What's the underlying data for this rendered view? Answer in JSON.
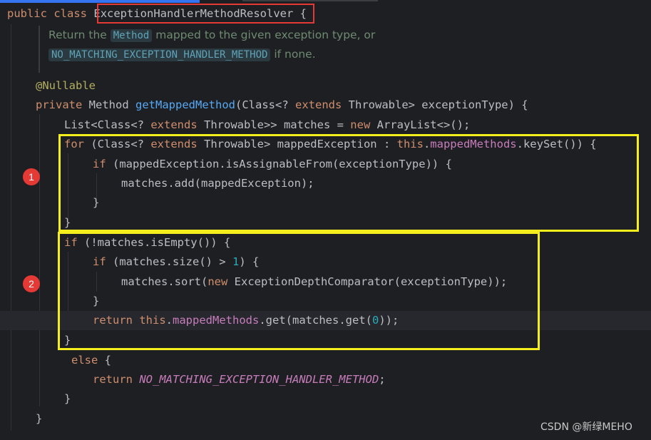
{
  "editor": {
    "class_decl": {
      "kw_public": "public",
      "kw_class": "class",
      "class_name": "ExceptionHandlerMethodResolver",
      "brace": "{"
    },
    "javadoc": {
      "line1_pre": "Return the ",
      "line1_code": "Method",
      "line1_post": " mapped to the given exception type, or",
      "line2_code": "NO_MATCHING_EXCEPTION_HANDLER_METHOD",
      "line2_post": " if none."
    },
    "annotation": "@Nullable",
    "method_decl": {
      "kw_private": "private",
      "type": "Method",
      "name": "getMappedMethod",
      "p1": "(Class<? ",
      "kw_extends": "extends",
      "p2": " Throwable> exceptionType) {"
    },
    "line_list": {
      "p1": "List<Class<? ",
      "kw_extends": "extends",
      "p2": " Throwable>> matches = ",
      "kw_new": "new",
      "p3": " ArrayList<>();"
    },
    "line_for": {
      "kw_for": "for",
      "p1": " (Class<? ",
      "kw_extends": "extends",
      "p2": " Throwable> mappedException : ",
      "kw_this": "this",
      "dot": ".",
      "field": "mappedMethods",
      "p3": ".keySet()) {"
    },
    "line_if_assign": {
      "kw_if": "if",
      "p1": " (mappedException.isAssignableFrom(exceptionType)) {"
    },
    "line_add": "matches.add(mappedException);",
    "close_brace_inner": "}",
    "close_brace_for": "}",
    "line_if_empty": {
      "kw_if": "if",
      "p1": " (!matches.isEmpty()) {"
    },
    "line_if_size": {
      "kw_if": "if",
      "p1": " (matches.size() > ",
      "num": "1",
      "p2": ") {"
    },
    "line_sort": {
      "p1": "matches.sort(",
      "kw_new": "new",
      "p2": " ExceptionDepthComparator(exceptionType));"
    },
    "close_brace_size": "}",
    "line_return_get": {
      "kw_return": "return",
      "kw_this": "this",
      "dot": ".",
      "field": "mappedMethods",
      "p1": ".get(matches.get(",
      "num": "0",
      "p2": "));"
    },
    "close_brace_if": "}",
    "line_else": {
      "kw_else": "else",
      "p1": " {"
    },
    "line_return_const": {
      "kw_return": "return",
      "const": "NO_MATCHING_EXCEPTION_HANDLER_METHOD",
      "semi": ";"
    },
    "close_brace_else": "}",
    "close_brace_method": "}"
  },
  "markers": [
    "1",
    "2"
  ],
  "watermark": "CSDN @新绿MEHO",
  "colors": {
    "background": "#1e1f22",
    "keyword": "#cf8e6d",
    "function": "#56a8f5",
    "field": "#c77dbb",
    "number": "#2aacb8",
    "annotation": "#b3ae60",
    "highlight_red": "#e53935",
    "highlight_yellow": "#f4ee1d"
  }
}
